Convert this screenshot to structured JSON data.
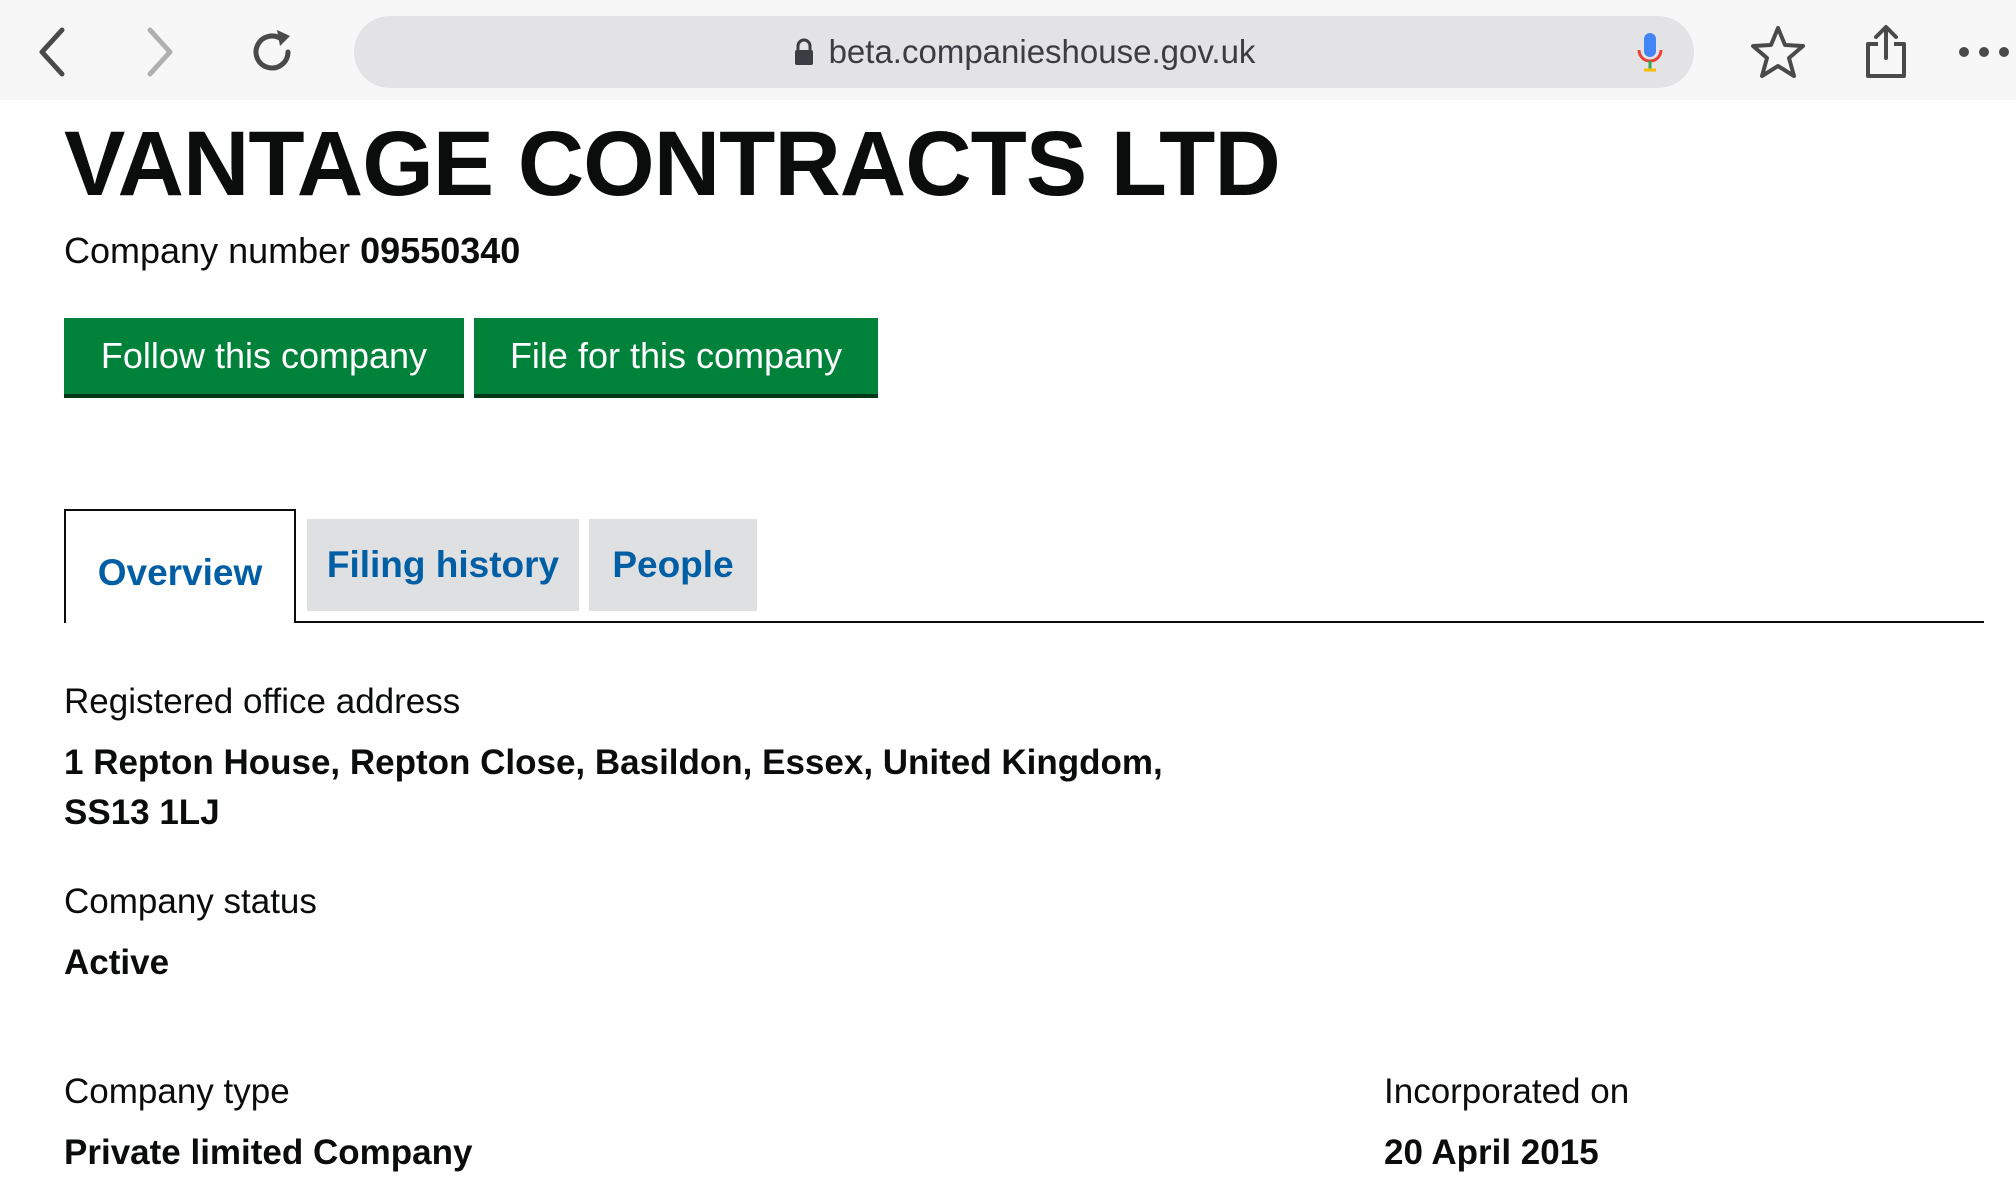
{
  "browser": {
    "url": "beta.companieshouse.gov.uk",
    "icons": [
      "back-icon",
      "forward-icon",
      "reload-icon",
      "lock-icon",
      "microphone-icon",
      "bookmark-star-icon",
      "share-icon",
      "more-icon"
    ]
  },
  "company": {
    "name": "VANTAGE CONTRACTS LTD",
    "number_label": "Company number",
    "number": "09550340"
  },
  "actions": {
    "follow_label": "Follow this company",
    "file_label": "File for this company"
  },
  "tabs": [
    {
      "label": "Overview",
      "active": true
    },
    {
      "label": "Filing history",
      "active": false
    },
    {
      "label": "People",
      "active": false
    }
  ],
  "overview": {
    "address_label": "Registered office address",
    "address_line1": "1 Repton House, Repton Close, Basildon, Essex, United Kingdom,",
    "address_line2": "SS13 1LJ",
    "status_label": "Company status",
    "status_value": "Active",
    "type_label": "Company type",
    "type_value": "Private limited Company",
    "incorporated_label": "Incorporated on",
    "incorporated_value": "20 April 2015"
  },
  "colors": {
    "button_green": "#00823b",
    "link_blue": "#005ea5",
    "tab_gray": "#dee0e2",
    "url_bar": "#e3e3e5"
  }
}
